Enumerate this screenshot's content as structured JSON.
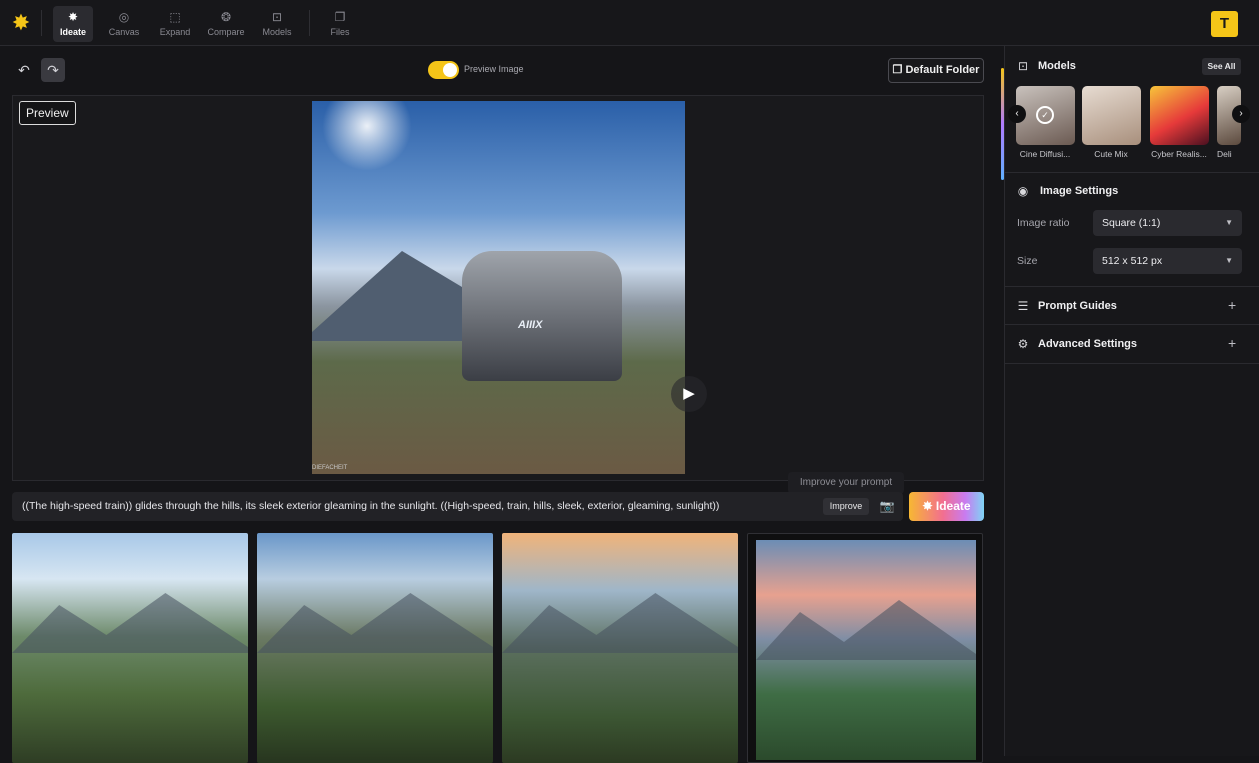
{
  "nav": {
    "items": [
      {
        "label": "Ideate",
        "icon": "ideate-icon",
        "glyph": "✸"
      },
      {
        "label": "Canvas",
        "icon": "canvas-icon",
        "glyph": "◎"
      },
      {
        "label": "Expand",
        "icon": "expand-icon",
        "glyph": "⬚"
      },
      {
        "label": "Compare",
        "icon": "compare-icon",
        "glyph": "❂"
      },
      {
        "label": "Models",
        "icon": "models-icon",
        "glyph": "⊡"
      },
      {
        "label": "Files",
        "icon": "files-icon",
        "glyph": "❐"
      }
    ],
    "active": "Ideate",
    "avatar_initial": "T"
  },
  "toolbar": {
    "preview_toggle_label": "Preview Image",
    "preview_toggle_on": true,
    "default_folder_label": "Default Folder"
  },
  "preview": {
    "tag_label": "Preview",
    "train_plate_text": "AIIIX",
    "watermark_text": "DIEFACHEIT"
  },
  "prompt": {
    "text": "((The high-speed train)) glides through the hills, its sleek exterior gleaming in the sunlight. ((High-speed, train, hills, sleek, exterior, gleaming, sunlight))",
    "improve_label": "Improve",
    "tooltip": "Improve your prompt",
    "ideate_label": "Ideate"
  },
  "sidebar": {
    "models": {
      "title": "Models",
      "see_all_label": "See All",
      "cards": [
        {
          "name": "Cine Diffusi..."
        },
        {
          "name": "Cute Mix"
        },
        {
          "name": "Cyber Realis..."
        },
        {
          "name": "Deli"
        }
      ]
    },
    "image_settings": {
      "title": "Image Settings",
      "ratio_label": "Image ratio",
      "ratio_value": "Square (1:1)",
      "size_label": "Size",
      "size_value": "512 x 512 px"
    },
    "prompt_guides": {
      "title": "Prompt Guides"
    },
    "advanced_settings": {
      "title": "Advanced Settings"
    }
  },
  "colors": {
    "accent": "#f5c518",
    "background": "#151518",
    "panel": "#17171a"
  }
}
